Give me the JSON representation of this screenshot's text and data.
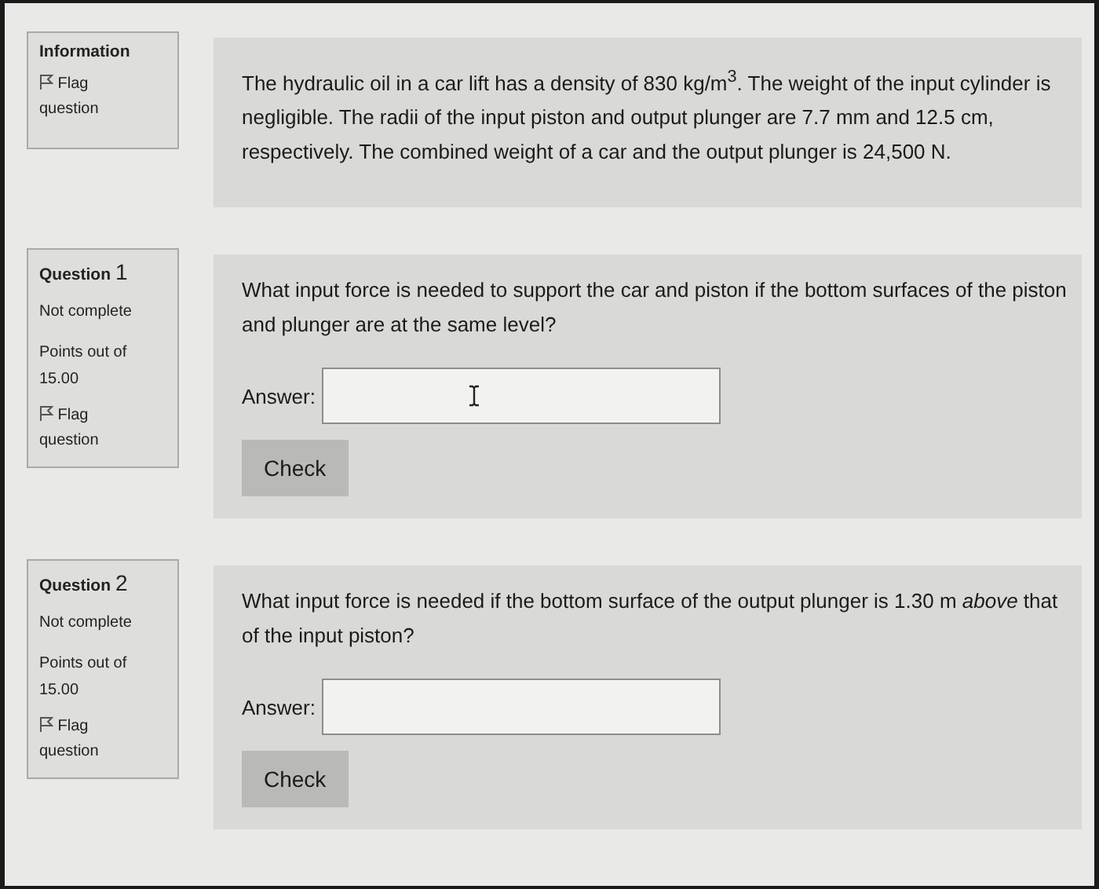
{
  "blocks": [
    {
      "kind": "info",
      "info": {
        "label": "Information",
        "flag": "Flag question"
      },
      "text": "The hydraulic oil in a car lift has a density of 830 kg/m$^{3}$. The weight of the input cylinder is negligible. The radii of the input piston and output plunger are 7.7 mm and 12.5 cm, respectively.  The combined weight of a car and the output plunger is 24,500 N."
    },
    {
      "kind": "question",
      "info": {
        "label": "Question",
        "number": "1",
        "status": "Not complete",
        "points": "Points out of 15.00",
        "flag": "Flag question"
      },
      "text": "What input force is needed to support the car and piston if the bottom surfaces of the piston and plunger are at the same level?",
      "answer_label": "Answer:",
      "text_cursor": true,
      "button": "Check"
    },
    {
      "kind": "question",
      "info": {
        "label": "Question",
        "number": "2",
        "status": "Not complete",
        "points": "Points out of 15.00",
        "flag": "Flag question"
      },
      "text": "What input force is needed if the bottom surface of the output plunger is 1.30 m *above* that of the input piston?",
      "answer_label": "Answer:",
      "text_cursor": false,
      "button": "Check"
    }
  ]
}
